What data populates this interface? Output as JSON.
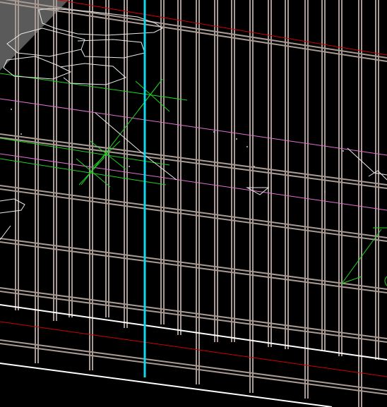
{
  "view": {
    "type": "cad-drawing-viewport",
    "background": "#000000",
    "colors": {
      "grid": "#a89a92",
      "cyan_axis": "#10d8f0",
      "red_line": "#d00000",
      "green_line": "#20d020",
      "magenta_line": "#e070d0",
      "white_line": "#ffffff",
      "sketch": "#e8e8e8",
      "grey_region": "#5a5a5a"
    }
  }
}
